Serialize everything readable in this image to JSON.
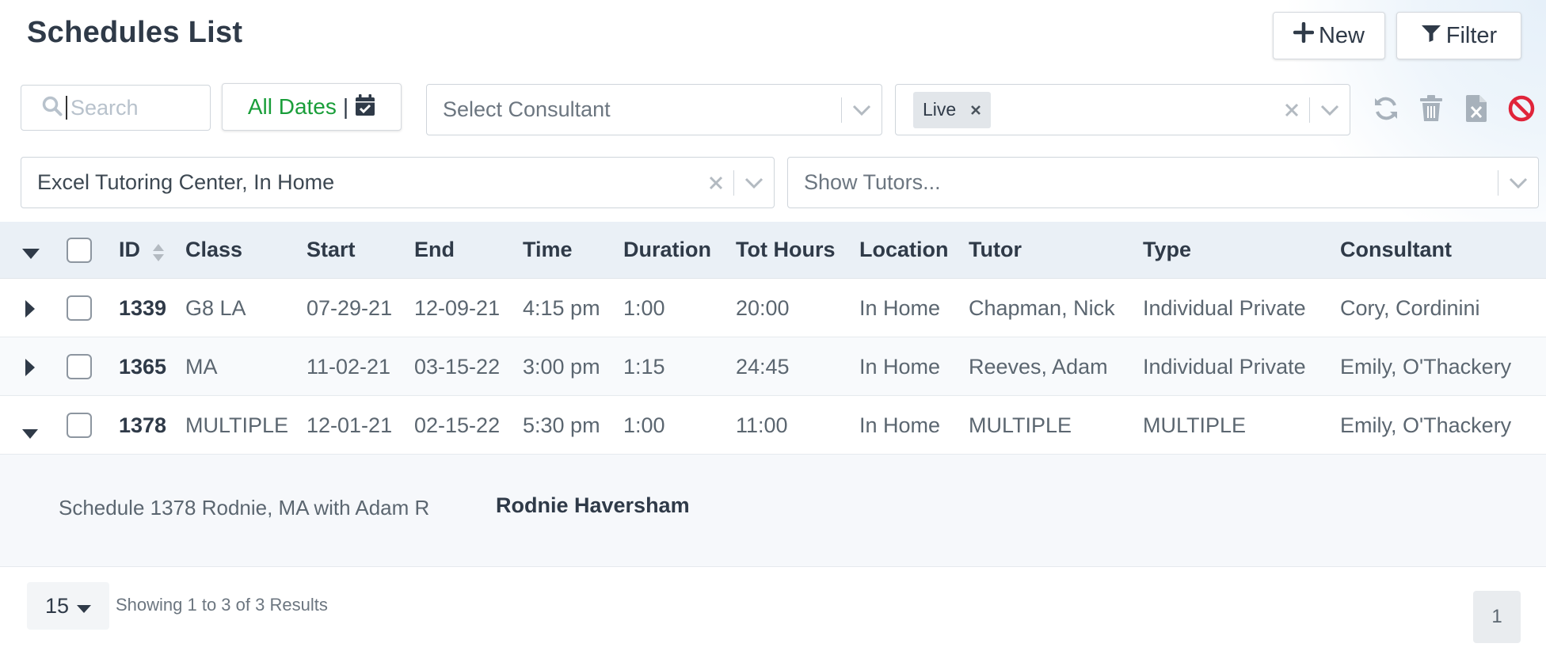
{
  "page": {
    "title": "Schedules List"
  },
  "toolbar": {
    "new_label": "New",
    "filter_label": "Filter"
  },
  "filters": {
    "search_placeholder": "Search",
    "dates_label": "All Dates",
    "dates_separator": "|",
    "consultant_placeholder": "Select Consultant",
    "status_tag": "Live",
    "location_value": "Excel Tutoring Center, In Home",
    "tutors_placeholder": "Show Tutors..."
  },
  "icons": {
    "refresh": "refresh-icon",
    "trash": "trash-icon",
    "excel": "excel-file-icon",
    "ban": "ban-icon"
  },
  "colors": {
    "accent_green": "#1a9e3a",
    "danger": "#e0243a",
    "header_bg": "#eaf0f6"
  },
  "table": {
    "columns": [
      "ID",
      "Class",
      "Start",
      "End",
      "Time",
      "Duration",
      "Tot Hours",
      "Location",
      "Tutor",
      "Type",
      "Consultant"
    ],
    "rows": [
      {
        "id": "1339",
        "class": "G8 LA",
        "start": "07-29-21",
        "end": "12-09-21",
        "time": "4:15 pm",
        "duration": "1:00",
        "tot_hours": "20:00",
        "location": "In Home",
        "tutor": "Chapman, Nick",
        "type": "Individual Private",
        "consultant": "Cory, Cordinini",
        "expanded": false
      },
      {
        "id": "1365",
        "class": "MA",
        "start": "11-02-21",
        "end": "03-15-22",
        "time": "3:00 pm",
        "duration": "1:15",
        "tot_hours": "24:45",
        "location": "In Home",
        "tutor": "Reeves, Adam",
        "type": "Individual Private",
        "consultant": "Emily, O'Thackery",
        "expanded": false
      },
      {
        "id": "1378",
        "class": "MULTIPLE",
        "start": "12-01-21",
        "end": "02-15-22",
        "time": "5:30 pm",
        "duration": "1:00",
        "tot_hours": "11:00",
        "location": "In Home",
        "tutor": "MULTIPLE",
        "type": "MULTIPLE",
        "consultant": "Emily, O'Thackery",
        "expanded": true
      }
    ],
    "detail": {
      "description": "Schedule 1378 Rodnie, MA with Adam R",
      "student": "Rodnie Haversham"
    }
  },
  "footer": {
    "per_page": "15",
    "showing": "Showing 1 to 3 of 3 Results",
    "current_page": "1"
  }
}
